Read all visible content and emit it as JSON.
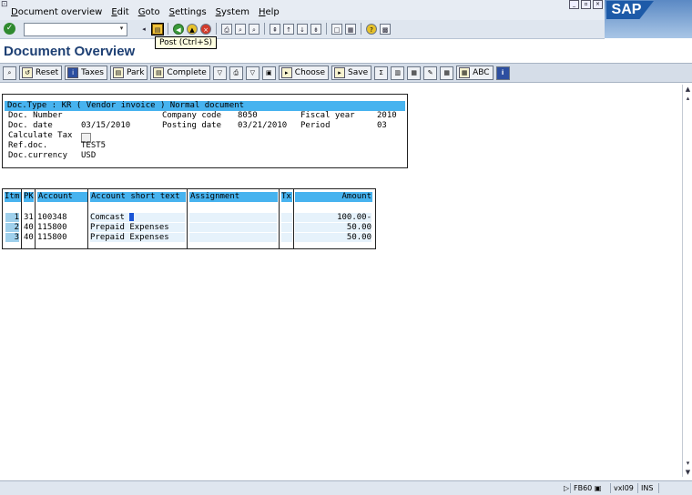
{
  "menu": {
    "items": [
      "Document overview",
      "Edit",
      "Goto",
      "Settings",
      "System",
      "Help"
    ]
  },
  "brand": {
    "logo_text": "SAP"
  },
  "tooltip": {
    "text": "Post  (Ctrl+S)"
  },
  "screen": {
    "title": "Document Overview"
  },
  "app_toolbar": {
    "reset": "Reset",
    "taxes": "Taxes",
    "park": "Park",
    "complete": "Complete",
    "choose": "Choose",
    "save": "Save",
    "abc": "ABC"
  },
  "header": {
    "doc_type_line": "Doc.Type : KR ( Vendor invoice ) Normal document",
    "doc_number_label": "Doc. Number",
    "doc_number_value": "",
    "company_code_label": "Company code",
    "company_code_value": "8050",
    "fiscal_year_label": "Fiscal year",
    "fiscal_year_value": "2010",
    "doc_date_label": "Doc. date",
    "doc_date_value": "03/15/2010",
    "posting_date_label": "Posting date",
    "posting_date_value": "03/21/2010",
    "period_label": "Period",
    "period_value": "03",
    "calc_tax_label": "Calculate Tax",
    "ref_doc_label": "Ref.doc.",
    "ref_doc_value": "TEST5",
    "currency_label": "Doc.currency",
    "currency_value": "USD"
  },
  "items_table": {
    "headers": {
      "itm": "Itm",
      "pk": "PK",
      "account": "Account",
      "short_text": "Account short text",
      "assignment": "Assignment",
      "tx": "Tx",
      "amount": "Amount"
    },
    "rows": [
      {
        "itm": "1",
        "pk": "31",
        "account": "100348",
        "short_text": "Comcast",
        "assignment": "",
        "tx": "",
        "amount": "100.00-"
      },
      {
        "itm": "2",
        "pk": "40",
        "account": "115800",
        "short_text": "Prepaid Expenses",
        "assignment": "",
        "tx": "",
        "amount": "50.00"
      },
      {
        "itm": "3",
        "pk": "40",
        "account": "115800",
        "short_text": "Prepaid Expenses",
        "assignment": "",
        "tx": "",
        "amount": "50.00"
      }
    ]
  },
  "status": {
    "transaction": "FB60",
    "server": "vxl09",
    "mode": "INS"
  }
}
